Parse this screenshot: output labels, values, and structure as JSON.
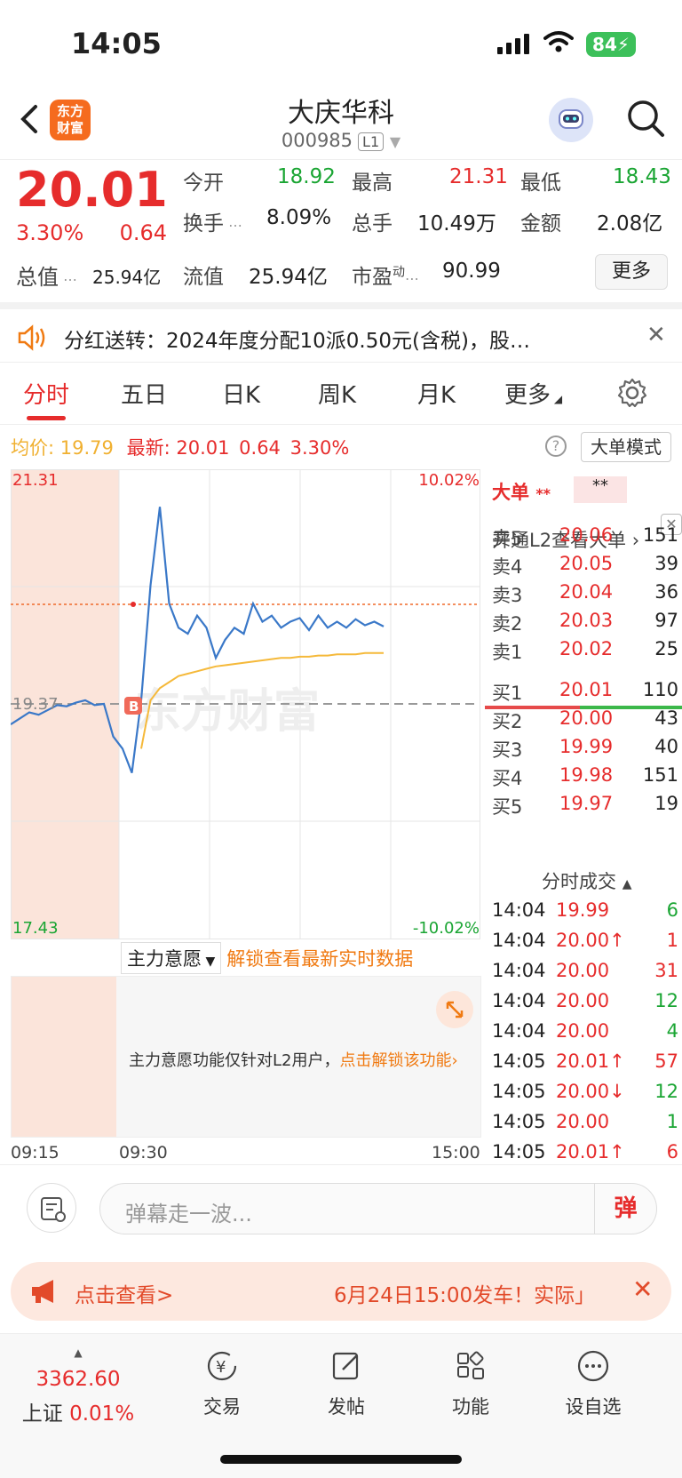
{
  "status": {
    "time": "14:05",
    "battery": "84"
  },
  "header": {
    "logo_line1": "东方",
    "logo_line2": "财富",
    "name": "大庆华科",
    "code": "000985",
    "level": "L1"
  },
  "quote": {
    "price": "20.01",
    "pct": "3.30%",
    "chg": "0.64",
    "total_value_label": "总值",
    "total_value": "25.94亿",
    "open_label": "今开",
    "open": "18.92",
    "high_label": "最高",
    "high": "21.31",
    "low_label": "最低",
    "low": "18.43",
    "turnover_label": "换手",
    "turnover": "8.09%",
    "volume_label": "总手",
    "volume": "10.49万",
    "amount_label": "金额",
    "amount": "2.08亿",
    "float_label": "流值",
    "float": "25.94亿",
    "pe_label": "市盈",
    "pe_sup": "动",
    "pe": "90.99",
    "more": "更多"
  },
  "dividend": {
    "text": "分红送转：2024年度分配10派0.50元(含税)，股…"
  },
  "tabs": [
    "分时",
    "五日",
    "日K",
    "周K",
    "月K",
    "更多"
  ],
  "infoline": {
    "avg_label": "均价:",
    "avg": "19.79",
    "latest_label": "最新:",
    "latest": "20.01",
    "chg": "0.64",
    "pct": "3.30%",
    "big_mode": "大单模式"
  },
  "chart_labels": {
    "y_top": "21.31",
    "y_mid": "19.37",
    "y_bottom": "17.43",
    "pct_top": "10.02%",
    "pct_bottom": "-10.02%",
    "t_start": "09:15",
    "t_open": "09:30",
    "t_end": "15:00",
    "marker": "B",
    "watermark": "东方财富"
  },
  "chart_data": {
    "type": "line",
    "ylim": [
      17.43,
      21.31
    ],
    "series": [
      {
        "name": "",
        "values": [
          19.2,
          19.25,
          19.3,
          19.28,
          19.32,
          19.36,
          19.35,
          19.38,
          19.4,
          19.36,
          19.37,
          19.1,
          19.0,
          18.8,
          19.4,
          20.35,
          21.0,
          20.2,
          20.0,
          19.95,
          20.1,
          20.0,
          19.75,
          19.9,
          20.0,
          19.95,
          20.2,
          20.05,
          20.1,
          20.0,
          20.05,
          20.08,
          19.98,
          20.1,
          20.0,
          20.05,
          20.0,
          20.07,
          20.02,
          20.05,
          20.01
        ]
      },
      {
        "name": "",
        "values": [
          null,
          null,
          null,
          null,
          null,
          null,
          null,
          null,
          null,
          null,
          null,
          null,
          null,
          null,
          19.0,
          19.4,
          19.5,
          19.55,
          19.6,
          19.62,
          19.64,
          19.66,
          19.68,
          19.69,
          19.7,
          19.71,
          19.72,
          19.73,
          19.74,
          19.75,
          19.75,
          19.76,
          19.76,
          19.77,
          19.77,
          19.78,
          19.78,
          19.78,
          19.79,
          19.79,
          19.79
        ]
      }
    ]
  },
  "subchart": {
    "selector": "主力意愿",
    "unlock": "解锁查看最新实时数据",
    "msg": "主力意愿功能仅针对L2用户，",
    "msg_link": "点击解锁该功能"
  },
  "panel": {
    "dadan": "大单",
    "dadan_stars": "**",
    "dadan_stars2": "**",
    "l2": "开通L2查看大单",
    "asks": [
      {
        "label": "卖5",
        "price": "20.06",
        "vol": "151"
      },
      {
        "label": "卖4",
        "price": "20.05",
        "vol": "39"
      },
      {
        "label": "卖3",
        "price": "20.04",
        "vol": "36"
      },
      {
        "label": "卖2",
        "price": "20.03",
        "vol": "97"
      },
      {
        "label": "卖1",
        "price": "20.02",
        "vol": "25"
      }
    ],
    "bids": [
      {
        "label": "买1",
        "price": "20.01",
        "vol": "110"
      },
      {
        "label": "买2",
        "price": "20.00",
        "vol": "43"
      },
      {
        "label": "买3",
        "price": "19.99",
        "vol": "40"
      },
      {
        "label": "买4",
        "price": "19.98",
        "vol": "151"
      },
      {
        "label": "买5",
        "price": "19.97",
        "vol": "19"
      }
    ],
    "ticks_title": "分时成交",
    "ticks": [
      {
        "time": "14:04",
        "price": "19.99",
        "vol": "6",
        "c": "green"
      },
      {
        "time": "14:04",
        "price": "20.00↑",
        "vol": "1",
        "c": "red"
      },
      {
        "time": "14:04",
        "price": "20.00",
        "vol": "31",
        "c": "red"
      },
      {
        "time": "14:04",
        "price": "20.00",
        "vol": "12",
        "c": "green"
      },
      {
        "time": "14:04",
        "price": "20.00",
        "vol": "4",
        "c": "green"
      },
      {
        "time": "14:05",
        "price": "20.01↑",
        "vol": "57",
        "c": "red"
      },
      {
        "time": "14:05",
        "price": "20.00↓",
        "vol": "12",
        "c": "green"
      },
      {
        "time": "14:05",
        "price": "20.00",
        "vol": "1",
        "c": "green"
      },
      {
        "time": "14:05",
        "price": "20.01↑",
        "vol": "6",
        "c": "red"
      }
    ]
  },
  "comment": {
    "placeholder": "弹幕走一波...",
    "dan": "弹"
  },
  "promo": {
    "t1": "点击查看>",
    "t2": "6月24日15:00发车！实际」"
  },
  "bottom": {
    "index_value": "3362.60",
    "index_name": "上证",
    "index_pct": "0.01%",
    "items": [
      "交易",
      "发帖",
      "功能",
      "设自选"
    ]
  }
}
